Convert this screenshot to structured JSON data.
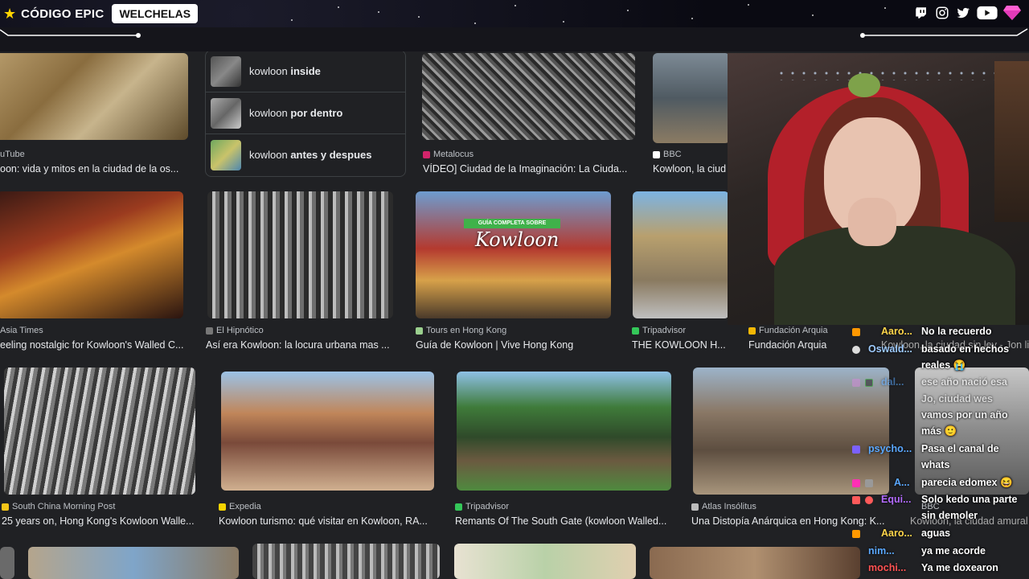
{
  "overlay": {
    "brand_code": "CÓDIGO EPIC",
    "brand_name": "WELCHELAS",
    "socials": [
      "twitch-icon",
      "instagram-icon",
      "twitter-icon",
      "youtube-icon"
    ]
  },
  "related": [
    {
      "prefix": "kowloon",
      "suffix": "inside"
    },
    {
      "prefix": "kowloon",
      "suffix": "por dentro"
    },
    {
      "prefix": "kowloon",
      "suffix": "antes y despues"
    }
  ],
  "row1": [
    {
      "source": "uTube",
      "title": "oon: vida y mitos en la ciudad de la os..."
    },
    {
      "source": "Metalocus",
      "title": "VÍDEO] Ciudad de la Imaginación: La Ciuda..."
    },
    {
      "source": "BBC",
      "title": "Kowloon, la ciud"
    }
  ],
  "row2": [
    {
      "source": "Asia Times",
      "title": "eeling nostalgic for Kowloon's Walled C..."
    },
    {
      "source": "El Hipnótico",
      "title": "Así era Kowloon: la locura urbana mas ..."
    },
    {
      "source": "Tours en Hong Kong",
      "title": "Guía de Kowloon | Vive Hong Kong"
    },
    {
      "source": "Tripadvisor",
      "title": "THE KOWLOON H..."
    },
    {
      "source": "Fundación Arquia",
      "title": "Fundación Arquia"
    }
  ],
  "row2_extra_title": "Kowloon, la ciudad sin ley - Jon li",
  "row3": [
    {
      "source": "South China Morning Post",
      "title": "25 years on, Hong Kong's Kowloon Walle..."
    },
    {
      "source": "Expedia",
      "title": "Kowloon turismo: qué visitar en Kowloon, RA..."
    },
    {
      "source": "Tripadvisor",
      "title": "Remants Of The South Gate (kowloon Walled..."
    },
    {
      "source": "Atlas Insólitus",
      "title": "Una Distopía Anárquica en Hong Kong: K..."
    }
  ],
  "row3_extra": {
    "source": "BBC",
    "title": "Kowloon, la ciudad amural"
  },
  "banner": {
    "top": "GUÍA COMPLETA SOBRE",
    "main": "Kowloon"
  },
  "chat": [
    {
      "user": "Aaro...",
      "msg": "No la recuerdo",
      "color": "#ffd54a"
    },
    {
      "user": "Oswald...",
      "msg": "basado en hechos",
      "color": "#9ecbff"
    },
    {
      "user": "",
      "msg": "reales 😭",
      "color": ""
    },
    {
      "user": "dal...",
      "msg": "ese año nació esa",
      "color": "#5aa8ff"
    },
    {
      "user": "",
      "msg": "Jo, ciudad wes",
      "color": ""
    },
    {
      "user": "",
      "msg": "vamos por un año",
      "color": ""
    },
    {
      "user": "",
      "msg": "más 🙂",
      "color": ""
    },
    {
      "user": "psycho...",
      "msg": "Pasa el canal de",
      "color": "#5aa8ff"
    },
    {
      "user": "",
      "msg": "whats",
      "color": ""
    },
    {
      "user": "A...",
      "msg": "parecia edomex 😆",
      "color": "#5aa8ff"
    },
    {
      "user": "Equi...",
      "msg": "Solo kedo una parte",
      "color": "#b36bff"
    },
    {
      "user": "",
      "msg": "sin demoler",
      "color": ""
    },
    {
      "user": "",
      "msg": "aguas",
      "color": ""
    },
    {
      "user": "Aaro...",
      "msg": "ya me acorde",
      "color": "#ffd54a"
    },
    {
      "user": "nim...",
      "msg": "ya me acorde",
      "color": "#5aa8ff"
    },
    {
      "user": "mochi...",
      "msg": "Ya me doxearon",
      "color": "#ff5252"
    }
  ]
}
